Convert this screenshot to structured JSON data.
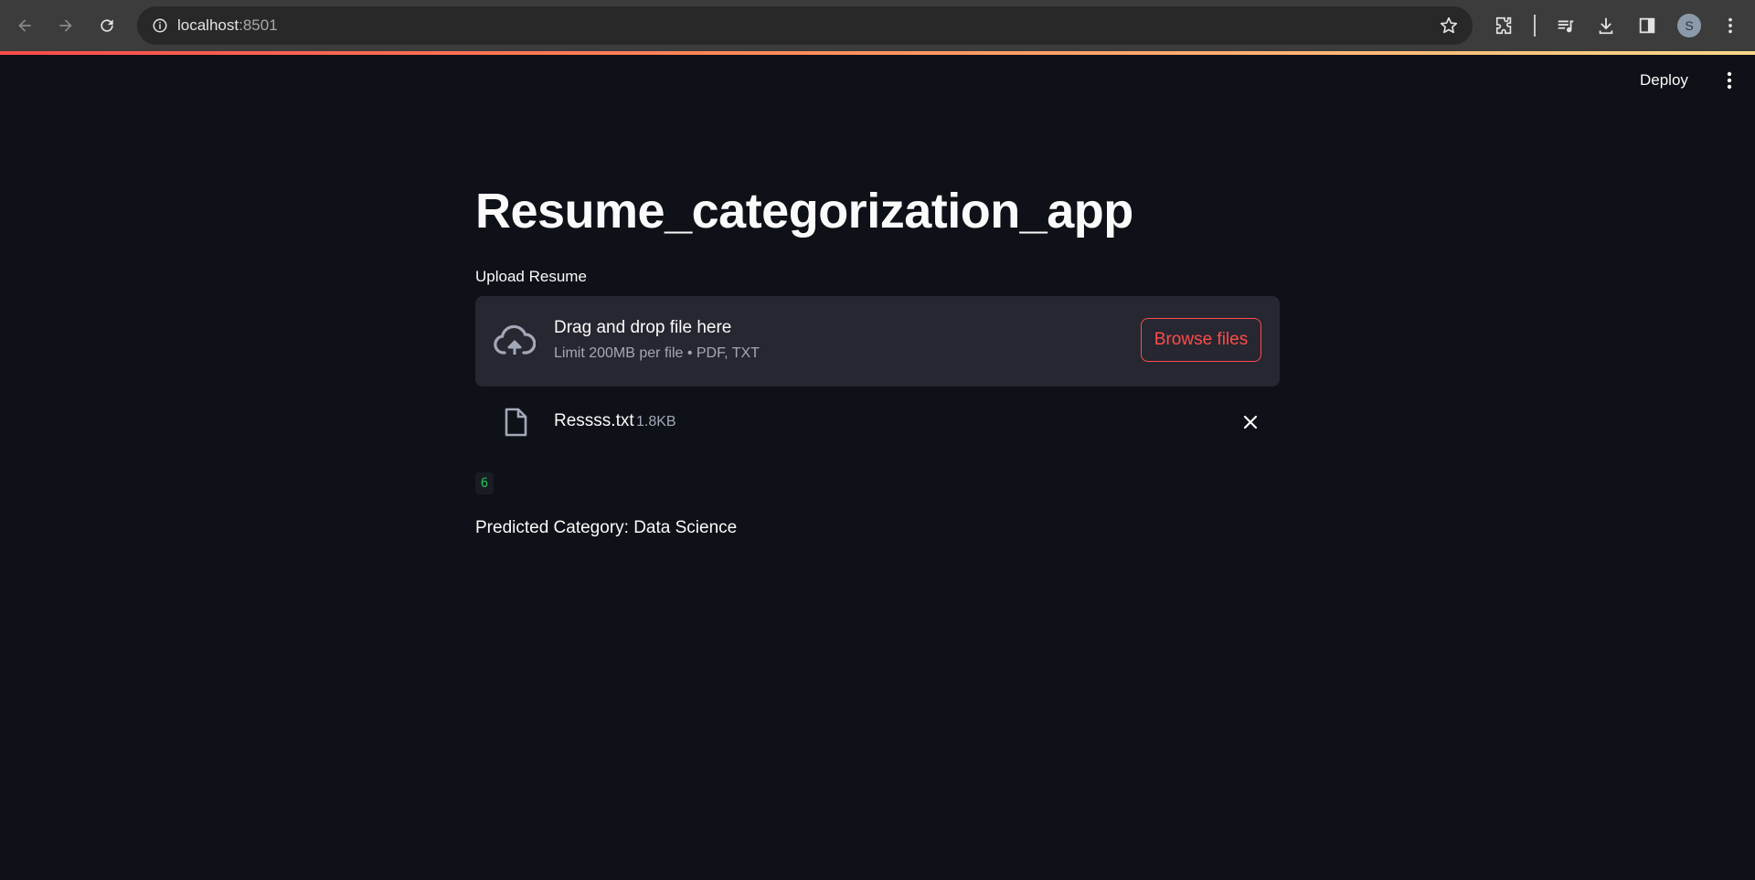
{
  "browser": {
    "url_host": "localhost",
    "url_port": ":8501",
    "avatar_letter": "S"
  },
  "header": {
    "deploy_label": "Deploy"
  },
  "app": {
    "title": "Resume_categorization_app",
    "upload_label": "Upload Resume",
    "dropzone": {
      "main_text": "Drag and drop file here",
      "sub_text": "Limit 200MB per file • PDF, TXT",
      "browse_label": "Browse files"
    },
    "uploaded_file": {
      "name": "Ressss.txt",
      "size": "1.8KB"
    },
    "code_output": "6",
    "prediction": "Predicted Category: Data Science"
  },
  "colors": {
    "background": "#0e1117",
    "accent": "#ff4b4b",
    "dropzone_bg": "#262730",
    "code_text": "#21c354"
  },
  "icons": [
    "back-icon",
    "forward-icon",
    "reload-icon",
    "info-icon",
    "star-icon",
    "extensions-icon",
    "media-icon",
    "download-icon",
    "side-panel-icon",
    "chrome-menu-icon",
    "kebab-menu-icon",
    "cloud-upload-icon",
    "file-icon",
    "close-icon"
  ]
}
